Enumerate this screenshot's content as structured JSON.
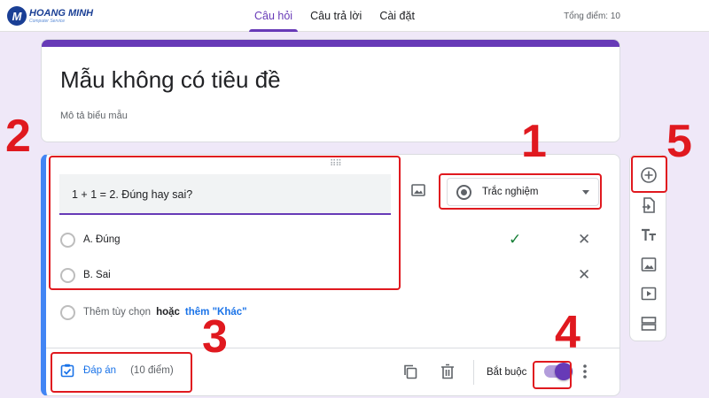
{
  "logo": {
    "name": "HOANG MINH",
    "tagline": "Computer Service"
  },
  "header": {
    "tabs": [
      {
        "label": "Câu hỏi",
        "active": true
      },
      {
        "label": "Câu trả lời",
        "active": false
      },
      {
        "label": "Cài đặt",
        "active": false
      }
    ],
    "total_points": "Tổng điểm: 10"
  },
  "form": {
    "title": "Mẫu không có tiêu đề",
    "description_placeholder": "Mô tả biểu mẫu"
  },
  "question": {
    "text": "1 + 1 = 2. Đúng hay sai?",
    "type": "Trắc nghiệm",
    "options": [
      {
        "label": "A. Đúng",
        "correct": true
      },
      {
        "label": "B. Sai",
        "correct": false
      }
    ],
    "add_option": "Thêm tùy chọn",
    "or": "hoặc",
    "add_other": "thêm \"Khác\"",
    "answer_key_label": "Đáp án",
    "points": "(10 điểm)",
    "required_label": "Bắt buộc",
    "required": true
  },
  "toolbar": {
    "items": [
      "add-question-icon",
      "import-questions-icon",
      "add-title-icon",
      "add-image-icon",
      "add-video-icon",
      "add-section-icon"
    ]
  },
  "annotations": [
    "1",
    "2",
    "3",
    "4",
    "5"
  ],
  "colors": {
    "accent": "#673ab7",
    "background": "#efe8f8",
    "active_question_border": "#4285f4",
    "annotation": "#e0191f",
    "link": "#1a73e8",
    "correct": "#188038"
  }
}
